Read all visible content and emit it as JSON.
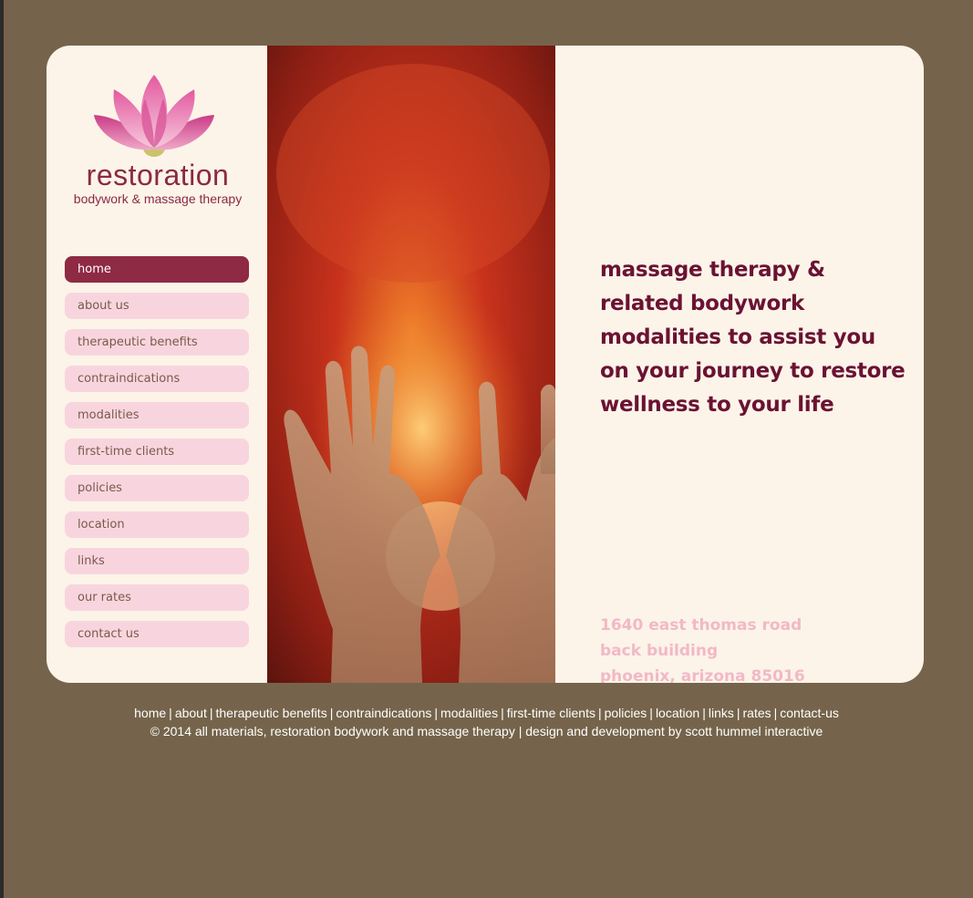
{
  "brand": {
    "name": "restoration",
    "tagline": "bodywork & massage therapy"
  },
  "nav": {
    "items": [
      {
        "label": "home",
        "active": true
      },
      {
        "label": "about us"
      },
      {
        "label": "therapeutic benefits"
      },
      {
        "label": "contraindications"
      },
      {
        "label": "modalities"
      },
      {
        "label": "first-time clients"
      },
      {
        "label": "policies"
      },
      {
        "label": "location"
      },
      {
        "label": "links"
      },
      {
        "label": "our rates"
      },
      {
        "label": "contact us"
      }
    ]
  },
  "hero": {
    "icon": "open-hands-image"
  },
  "main": {
    "tagline_lines": [
      "massage therapy &",
      "related bodywork",
      "modalities to assist you",
      "on your journey to restore",
      "wellness to your life"
    ],
    "address_lines": [
      "1640 east thomas road",
      "back building",
      "phoenix, arizona 85016"
    ]
  },
  "footer": {
    "links": [
      "home",
      "about",
      "therapeutic benefits",
      "contraindications",
      "modalities",
      "first-time clients",
      "policies",
      "location",
      "links",
      "rates",
      "contact-us"
    ],
    "separator": "|",
    "copyright": "© 2014 all materials, restoration bodywork and massage therapy | design and development by scott hummel interactive"
  },
  "colors": {
    "page_bg": "#75644b",
    "card_bg": "#fcf4e8",
    "accent": "#8e2a44",
    "nav_bg": "#f8d5de",
    "tagline": "#6a1234",
    "address": "#f2b8c8"
  }
}
